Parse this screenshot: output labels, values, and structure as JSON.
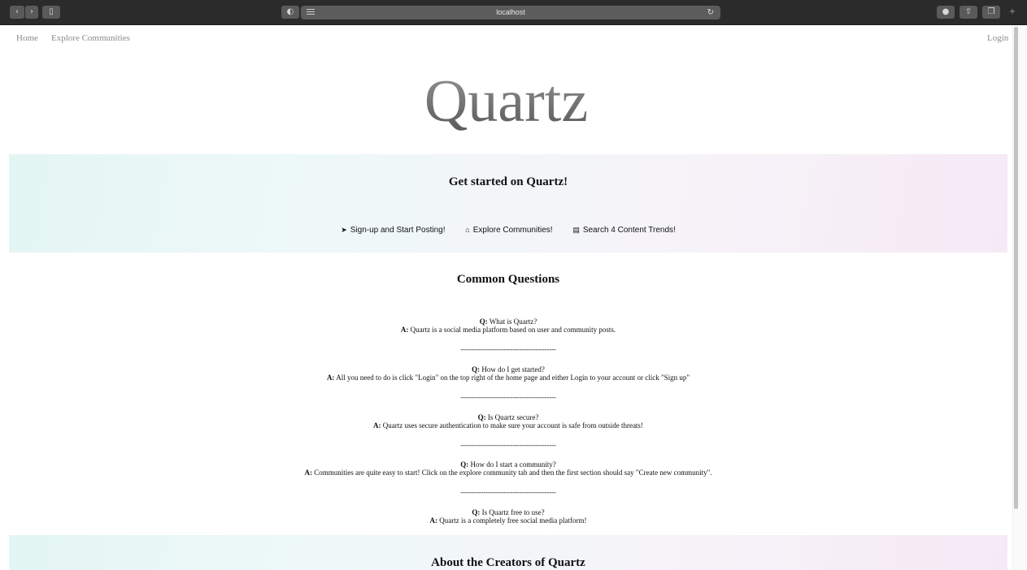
{
  "browser": {
    "url": "localhost",
    "back_icon": "chevron-left-icon",
    "forward_icon": "chevron-right-icon",
    "sidebar_icon": "sidebar-icon",
    "privacy_icon": "shield-icon",
    "reader_icon": "reader-icon",
    "reload_icon": "reload-icon",
    "download_icon": "download-icon",
    "share_icon": "share-icon",
    "tabs_icon": "tabs-icon",
    "new_tab_icon": "plus-icon"
  },
  "nav": {
    "home": "Home",
    "explore": "Explore Communities",
    "login": "Login"
  },
  "logo": "Quartz",
  "get_started": {
    "title": "Get started on Quartz!",
    "links": [
      {
        "icon": "paper-plane-icon",
        "label": "Sign-up and Start Posting!"
      },
      {
        "icon": "home-icon",
        "label": "Explore Communities!"
      },
      {
        "icon": "newspaper-icon",
        "label": "Search 4 Content Trends!"
      }
    ]
  },
  "faq": {
    "title": "Common Questions",
    "q_prefix": "Q:",
    "a_prefix": "A:",
    "separator": "------------------------------------------",
    "items": [
      {
        "q": "What is Quartz?",
        "a": "Quartz is a social media platform based on user and community posts."
      },
      {
        "q": "How do I get started?",
        "a": "All you need to do is click \"Login\" on the top right of the home page and either Login to your account or click \"Sign up\""
      },
      {
        "q": "Is Quartz secure?",
        "a": "Quartz uses secure authentication to make sure your account is safe from outside threats!"
      },
      {
        "q": "How do I start a community?",
        "a": "Communities are quite easy to start! Click on the explore community tab and then the first section should say \"Create new community\"."
      },
      {
        "q": "Is Quartz free to use?",
        "a": "Quartz is a completely free social media platform!"
      }
    ]
  },
  "about": {
    "title": "About the Creators of Quartz"
  },
  "colors": {
    "chrome_bg": "#2b2b2b",
    "panel_start": "#e3f6f3",
    "panel_end": "#f6e9f6",
    "nav_text": "#8a8a8a"
  }
}
